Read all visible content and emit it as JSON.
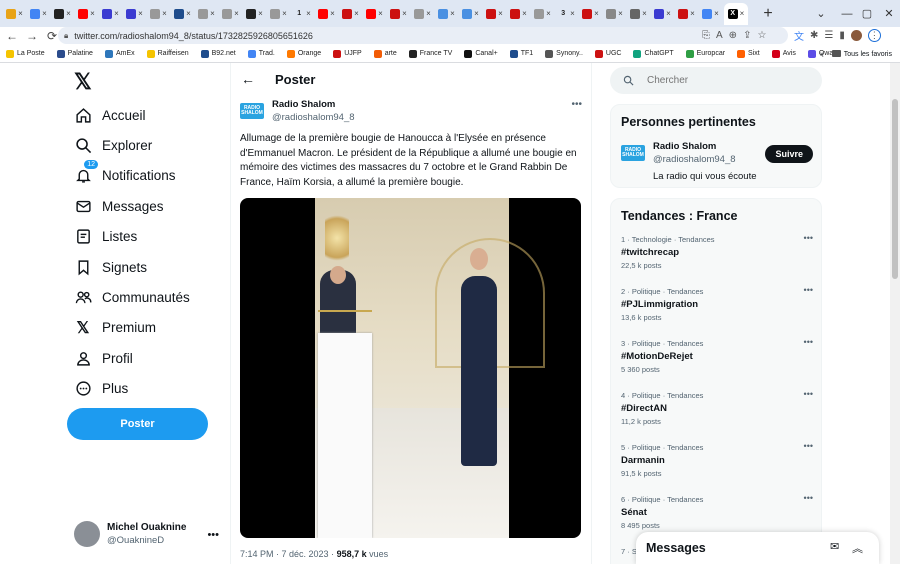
{
  "browser": {
    "tabs": [
      {
        "icon": "map-pin-icon",
        "color": "#e8a317"
      },
      {
        "icon": "translate-icon",
        "color": "#4285f4"
      },
      {
        "icon": "news-icon",
        "color": "#222222"
      },
      {
        "icon": "youtube-icon",
        "color": "#ff0000"
      },
      {
        "icon": "p-icon",
        "color": "#3b3bd1"
      },
      {
        "icon": "p-icon",
        "color": "#3b3bd1"
      },
      {
        "icon": "circle-icon",
        "color": "#999999"
      },
      {
        "icon": "news-icon",
        "color": "#1e4c8c"
      },
      {
        "icon": "circle-icon",
        "color": "#999999"
      },
      {
        "icon": "circle-icon",
        "color": "#999999"
      },
      {
        "icon": "news-icon",
        "color": "#222222"
      },
      {
        "icon": "circle-icon",
        "color": "#999999"
      },
      {
        "icon": "num-icon",
        "color": "#222222",
        "text": "1"
      },
      {
        "icon": "youtube-icon",
        "color": "#ff0000"
      },
      {
        "icon": "target-icon",
        "color": "#cc1111"
      },
      {
        "icon": "youtube-icon",
        "color": "#ff0000"
      },
      {
        "icon": "target-icon",
        "color": "#cc1111"
      },
      {
        "icon": "circle-icon",
        "color": "#999999"
      },
      {
        "icon": "circle-icon",
        "color": "#4a90e2"
      },
      {
        "icon": "circle-icon",
        "color": "#4a90e2"
      },
      {
        "icon": "dash-icon",
        "color": "#cc1111"
      },
      {
        "icon": "dash-icon",
        "color": "#cc1111"
      },
      {
        "icon": "circle-icon",
        "color": "#999999"
      },
      {
        "icon": "num-icon",
        "color": "#222222",
        "text": "3"
      },
      {
        "icon": "target-icon",
        "color": "#cc1111"
      },
      {
        "icon": "gear-icon",
        "color": "#888888"
      },
      {
        "icon": "image-icon",
        "color": "#666666"
      },
      {
        "icon": "p-icon",
        "color": "#3b3bd1"
      },
      {
        "icon": "mail-icon",
        "color": "#cc1111"
      },
      {
        "icon": "translate-icon",
        "color": "#4285f4"
      }
    ],
    "active_tab_icon": "x-logo-icon",
    "url": "twitter.com/radioshalom94_8/status/1732825926805651626",
    "bookmarks": [
      {
        "label": "La Poste",
        "color": "#f5c400"
      },
      {
        "label": "Palatine",
        "color": "#2b4c8c"
      },
      {
        "label": "AmEx",
        "color": "#2e77bb"
      },
      {
        "label": "Raiffeisen",
        "color": "#f5c400"
      },
      {
        "label": "B92.net",
        "color": "#1e4c8c"
      },
      {
        "label": "Trad.",
        "color": "#4285f4"
      },
      {
        "label": "Orange",
        "color": "#ff7900"
      },
      {
        "label": "UJFP",
        "color": "#cc1111"
      },
      {
        "label": "arte",
        "color": "#f25c05"
      },
      {
        "label": "France TV",
        "color": "#222222"
      },
      {
        "label": "Canal+",
        "color": "#111111"
      },
      {
        "label": "TF1",
        "color": "#1e4c8c"
      },
      {
        "label": "Synony..",
        "color": "#555555"
      },
      {
        "label": "UGC",
        "color": "#cc1111"
      },
      {
        "label": "ChatGPT",
        "color": "#10a37f"
      },
      {
        "label": "Europcar",
        "color": "#2f9e44"
      },
      {
        "label": "Sixt",
        "color": "#ff5f00"
      },
      {
        "label": "Avis",
        "color": "#d4001a"
      },
      {
        "label": "Qwant",
        "color": "#5c4de6"
      }
    ],
    "more_bookmarks": "»",
    "all_bookmarks": "Tous les favoris"
  },
  "nav": {
    "items": [
      {
        "label": "Accueil",
        "icon": "home-icon"
      },
      {
        "label": "Explorer",
        "icon": "search-icon"
      },
      {
        "label": "Notifications",
        "icon": "bell-icon",
        "badge": "12"
      },
      {
        "label": "Messages",
        "icon": "mail-icon"
      },
      {
        "label": "Listes",
        "icon": "list-icon"
      },
      {
        "label": "Signets",
        "icon": "bookmark-icon"
      },
      {
        "label": "Communautés",
        "icon": "people-icon"
      },
      {
        "label": "Premium",
        "icon": "x-logo-icon"
      },
      {
        "label": "Profil",
        "icon": "user-icon"
      },
      {
        "label": "Plus",
        "icon": "more-circle-icon"
      }
    ],
    "post_button": "Poster",
    "account": {
      "name": "Michel Ouaknine",
      "handle": "@OuaknineD"
    }
  },
  "main": {
    "header": "Poster",
    "author": {
      "name": "Radio Shalom",
      "handle": "@radioshalom94_8"
    },
    "logo_text": "RADIO SHALOM",
    "text": "Allumage de la première bougie de Hanoucca à l'Elysée en présence d'Emmanuel Macron. Le président de la République a allumé une bougie en mémoire des victimes des massacres du 7 octobre et le Grand Rabbin De France, Haïm Korsia, a allumé la première bougie.",
    "time": "7:14 PM · 7 déc. 2023 · ",
    "views_count": "958,7 k",
    "views_label": " vues"
  },
  "right": {
    "search_placeholder": "Chercher",
    "relevant": {
      "title": "Personnes pertinentes",
      "name": "Radio Shalom",
      "handle": "@radioshalom94_8",
      "bio": "La radio qui vous écoute",
      "follow": "Suivre"
    },
    "trends": {
      "title": "Tendances : France",
      "items": [
        {
          "context": "1 · Technologie · Tendances",
          "name": "#twitchrecap",
          "posts": "22,5 k posts"
        },
        {
          "context": "2 · Politique · Tendances",
          "name": "#PJLimmigration",
          "posts": "13,6 k posts"
        },
        {
          "context": "3 · Politique · Tendances",
          "name": "#MotionDeRejet",
          "posts": "5 360 posts"
        },
        {
          "context": "4 · Politique · Tendances",
          "name": "#DirectAN",
          "posts": "11,2 k posts"
        },
        {
          "context": "5 · Politique · Tendances",
          "name": "Darmanin",
          "posts": "91,5 k posts"
        },
        {
          "context": "6 · Politique · Tendances",
          "name": "Sénat",
          "posts": "8 495 posts"
        },
        {
          "context": "7 · S",
          "name": "",
          "posts": ""
        }
      ]
    },
    "messages_drawer": "Messages"
  },
  "colors": {
    "accent": "#1d9bf0",
    "text": "#0f1419",
    "muted": "#536471"
  }
}
